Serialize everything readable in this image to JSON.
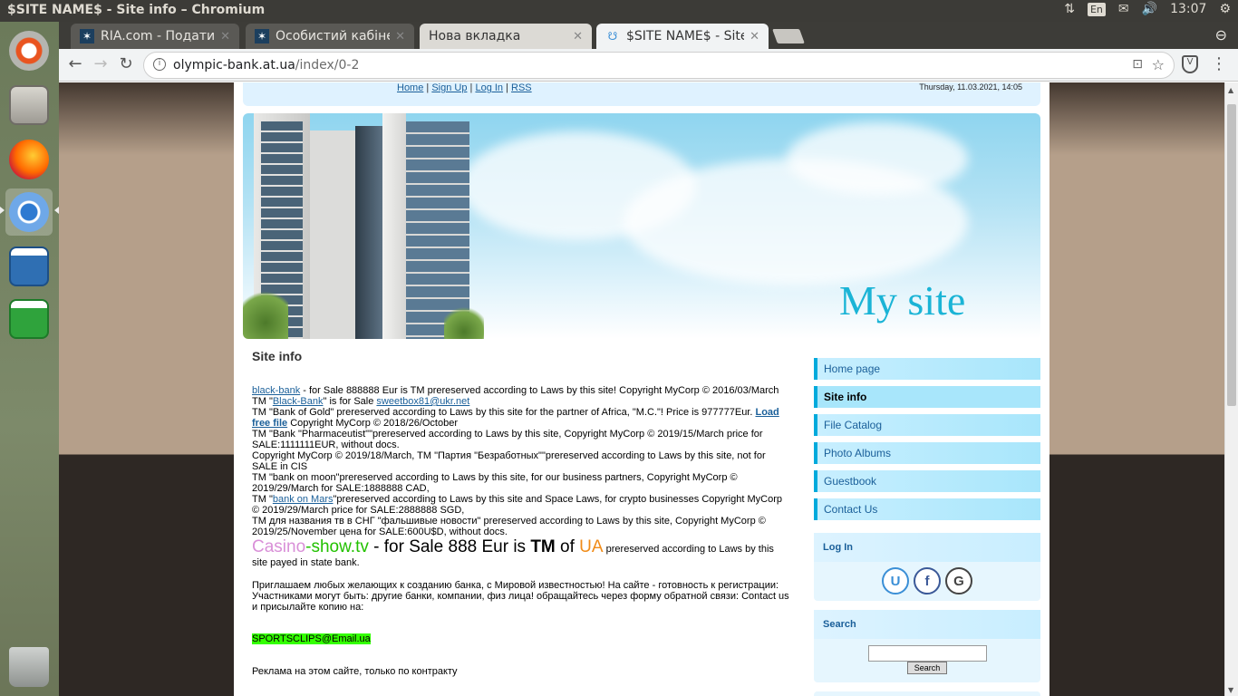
{
  "os": {
    "window_title": "$SITE NAME$ - Site info – Chromium",
    "keyboard_layout": "En",
    "clock": "13:07"
  },
  "browser": {
    "tabs": [
      {
        "label": "RIA.com - Подати о",
        "icon": "ria-icon"
      },
      {
        "label": "Особистий кабінет",
        "icon": "ria-icon"
      },
      {
        "label": "Нова вкладка",
        "icon": "none"
      },
      {
        "label": "$SITE NAME$ - Site",
        "icon": "ucoz-icon"
      }
    ],
    "url_host": "olympic-bank.at.ua",
    "url_path": "/index/0-2"
  },
  "page": {
    "topnav": [
      "Home",
      "Sign Up",
      "Log In",
      "RSS"
    ],
    "topnav_sep": "|",
    "date": "Thursday, 11.03.2021, 14:05",
    "site_title": "My site",
    "heading": "Site info",
    "content": {
      "l1_link": "black-bank",
      "l1_text": " - for Sale 888888 Eur is TM prereserved according to Laws by this site! Copyright MyCorp © 2016/03/March",
      "l2_pre": "TM \"",
      "l2_link": "Black-Bank",
      "l2_mid": "\" is for Sale ",
      "l2_email": "sweetbox81@ukr.net",
      "l3_text": "TM \"Bank of Gold\" prereserved according to Laws by this site for the partner of Africa, \"M.C.\"! Price is 977777Eur. ",
      "l3_link": "Load free file",
      "l3_tail": " Copyright MyCorp © 2018/26/October",
      "l4": "TM \"Bank \"Pharmaceutist\"\"prereserved according to Laws by this site, Copyright MyCorp © 2019/15/March price for SALE:1111111EUR, without docs.",
      "l5": "Copyright MyCorp © 2019/18/March, TM \"Партия \"Безработных\"\"prereserved according to Laws by this site, not for SALE in CIS",
      "l6": "TM \"bank on moon\"prereserved according to Laws by this site, for our business partners, Copyright MyCorp © 2019/29/March for SALE:1888888 CAD,",
      "l7_pre": "TM \"",
      "l7_link": "bank on Mars",
      "l7_text": "\"prereserved according to Laws by this site and Space Laws, for crypto businesses Copyright MyCorp © 2019/29/March price for SALE:2888888 SGD,",
      "l8": "TM для названия тв в СНГ \"фальшивые новости\" prereserved according to Laws by this site, Copyright MyCorp © 2019/25/November цена for SALE:600U$D, without docs.",
      "promo_casino": "Casino",
      "promo_dash": "-",
      "promo_show": "show.tv",
      "promo_mid": " - for Sale 888 Eur is ",
      "promo_tm": "TM",
      "promo_of": " of ",
      "promo_ua": "UA",
      "promo_tail": " prereserved according to Laws by this site payed in state bank.",
      "invite": "Приглашаем любых желающих к созданию банка, с Мировой известностью! На сайте - готовность к регистрации: Участниками могут быть: другие банки, компании, физ лица! обращайтесь через форму обратной связи: Contact us и присылайте копию на:",
      "email_hl": "SPORTSCLIPS@Email.ua",
      "cut_line": "Реклама на этом сайте, только по контракту"
    },
    "menu": [
      {
        "label": "Home page",
        "current": false
      },
      {
        "label": "Site info",
        "current": true
      },
      {
        "label": "File Catalog",
        "current": false
      },
      {
        "label": "Photo Albums",
        "current": false
      },
      {
        "label": "Guestbook",
        "current": false
      },
      {
        "label": "Contact Us",
        "current": false
      }
    ],
    "login_title": "Log In",
    "login_icons": [
      {
        "glyph": "U",
        "icon": "ucoz-login-icon",
        "color": "#3b8fd6"
      },
      {
        "glyph": "f",
        "icon": "facebook-icon",
        "color": "#3b5998"
      },
      {
        "glyph": "G",
        "icon": "google-icon",
        "color": "#444444"
      }
    ],
    "search_title": "Search",
    "search_button": "Search",
    "search_value": ""
  },
  "colors": {
    "accent": "#00aadc",
    "link": "#1a5f99",
    "site_title": "#1bb4d6",
    "highlight": "#33ff00"
  }
}
